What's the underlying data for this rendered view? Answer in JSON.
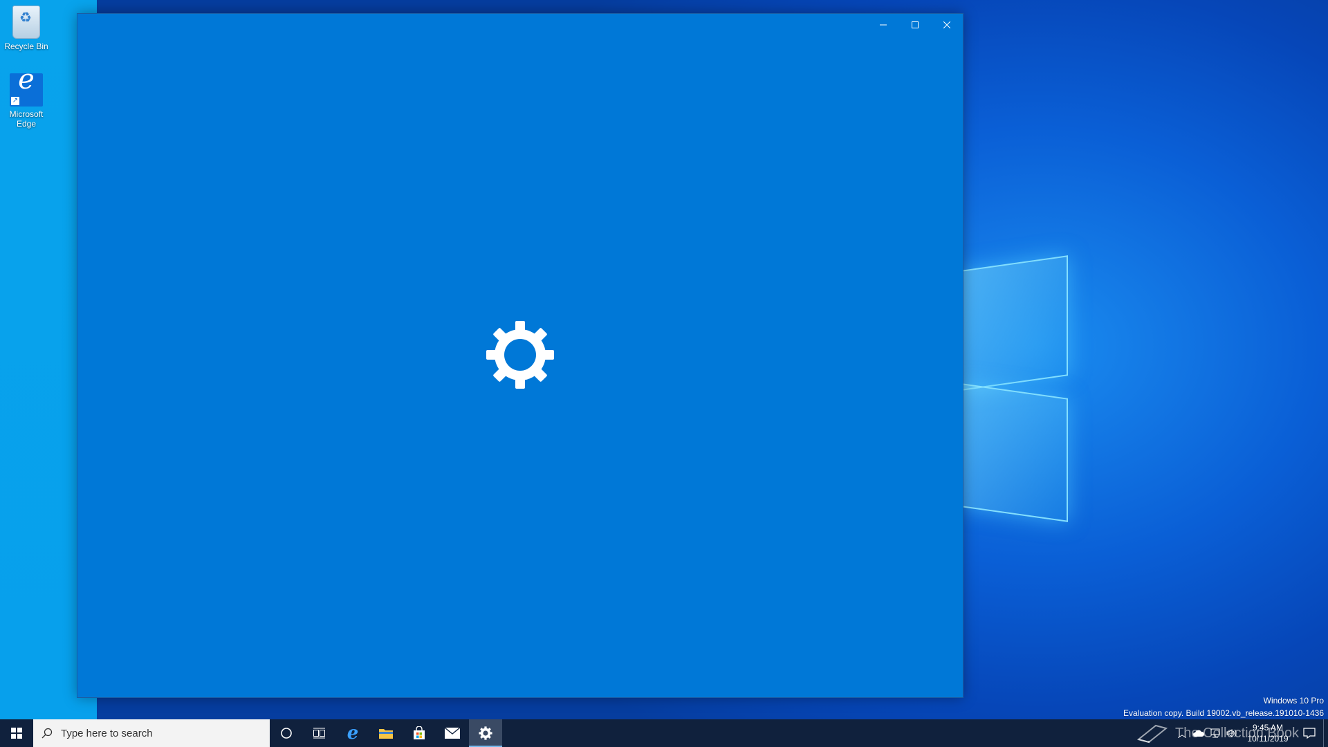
{
  "desktop": {
    "icons": [
      {
        "label": "Recycle Bin",
        "icon": "recycle-bin-icon"
      },
      {
        "label": "Microsoft Edge",
        "icon": "edge-icon"
      }
    ],
    "watermark": {
      "line1": "Windows 10 Pro",
      "line2": "Evaluation copy. Build 19002.vb_release.191010-1436"
    },
    "overlay_logo_text": "The Collection Book"
  },
  "window": {
    "app": "Settings",
    "state": "loading-splash",
    "splash_icon": "gear-icon",
    "background_color": "#0078d7",
    "controls": [
      "minimize",
      "maximize",
      "close"
    ]
  },
  "taskbar": {
    "search_placeholder": "Type here to search",
    "pinned": [
      {
        "name": "Cortana",
        "icon": "cortana-circle-icon"
      },
      {
        "name": "Task View",
        "icon": "task-view-icon"
      },
      {
        "name": "Microsoft Edge",
        "icon": "edge-icon"
      },
      {
        "name": "File Explorer",
        "icon": "folder-icon"
      },
      {
        "name": "Microsoft Store",
        "icon": "store-bag-icon"
      },
      {
        "name": "Mail",
        "icon": "mail-icon"
      },
      {
        "name": "Settings",
        "icon": "gear-icon",
        "active": true
      }
    ],
    "clock": {
      "time": "9:45 AM",
      "date": "10/11/2019"
    },
    "tray_icons": [
      "chevron-up-icon",
      "onedrive-cloud-icon",
      "network-icon",
      "volume-icon"
    ],
    "background_color": "#10213d"
  }
}
